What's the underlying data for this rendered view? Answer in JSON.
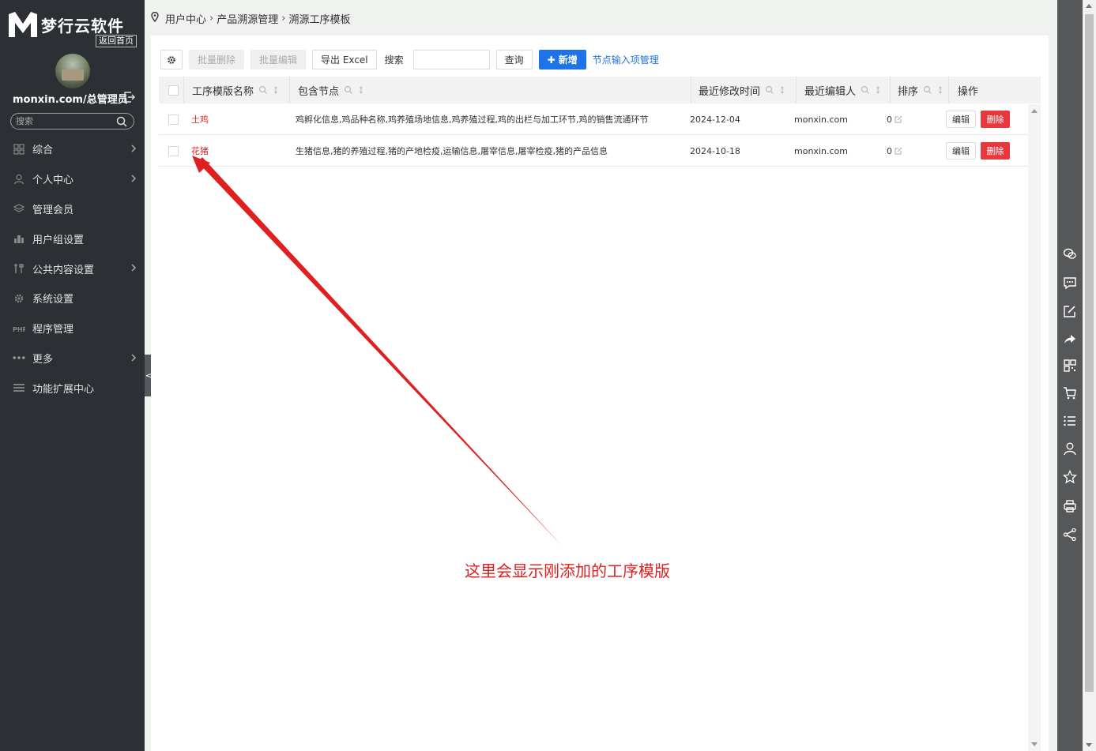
{
  "sidebar": {
    "logo_text": "梦行云软件",
    "back_home": "返回首页",
    "user_name": "monxin.com/总管理员",
    "search_placeholder": "搜索",
    "items": [
      {
        "label": "综合",
        "icon": "grid-icon",
        "has_arrow": true
      },
      {
        "label": "个人中心",
        "icon": "user-icon",
        "has_arrow": true
      },
      {
        "label": "管理会员",
        "icon": "layers-icon",
        "has_arrow": false
      },
      {
        "label": "用户组设置",
        "icon": "building-icon",
        "has_arrow": false
      },
      {
        "label": "公共内容设置",
        "icon": "tools-icon",
        "has_arrow": true
      },
      {
        "label": "系统设置",
        "icon": "gear-icon",
        "has_arrow": false
      },
      {
        "label": "程序管理",
        "icon": "php-icon",
        "has_arrow": false
      },
      {
        "label": "更多",
        "icon": "dots-icon",
        "has_arrow": true
      },
      {
        "label": "功能扩展中心",
        "icon": "menu-icon",
        "has_arrow": false
      }
    ]
  },
  "breadcrumb": [
    "用户中心",
    "产品溯源管理",
    "溯源工序模板"
  ],
  "toolbar": {
    "batch_delete": "批量删除",
    "batch_edit": "批量编辑",
    "export_excel": "导出 Excel",
    "search_label": "搜索",
    "search_value": "",
    "query": "查询",
    "add_new": "新增",
    "node_input_manage": "节点输入项管理"
  },
  "table": {
    "headers": [
      "工序模版名称",
      "包含节点",
      "最近修改时间",
      "最近编辑人",
      "排序",
      "操作"
    ],
    "rows": [
      {
        "name": "土鸡",
        "nodes": "鸡孵化信息,鸡品种名称,鸡养殖场地信息,鸡养殖过程,鸡的出栏与加工环节,鸡的销售流通环节",
        "modified": "2024-12-04",
        "editor": "monxin.com",
        "sort": "0",
        "edit": "编辑",
        "delete": "删除"
      },
      {
        "name": "花猪",
        "nodes": "生猪信息,猪的养殖过程,猪的产地检疫,运输信息,屠宰信息,屠宰检疫,猪的产品信息",
        "modified": "2024-10-18",
        "editor": "monxin.com",
        "sort": "0",
        "edit": "编辑",
        "delete": "删除"
      }
    ]
  },
  "annotation": {
    "text": "这里会显示刚添加的工序模版",
    "color": "#e02020"
  },
  "right_toolbar": [
    "wechat-icon",
    "message-icon",
    "edit-icon",
    "share-arrow-icon",
    "qrcode-icon",
    "cart-icon",
    "list-icon",
    "user-icon",
    "star-icon",
    "print-icon",
    "share-icon"
  ],
  "colors": {
    "sidebar_bg": "#2c2f33",
    "primary": "#1e73e8",
    "danger": "#e8373d",
    "name_red": "#e02020"
  }
}
